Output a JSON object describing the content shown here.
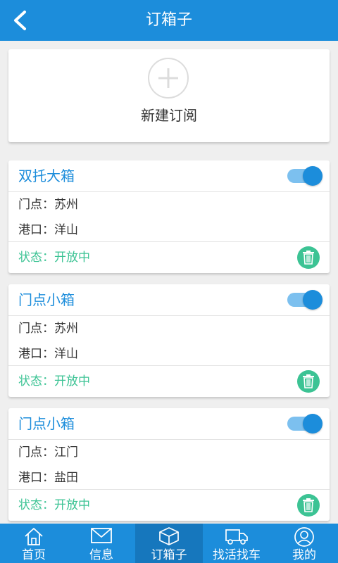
{
  "header": {
    "title": "订箱子"
  },
  "new_subscription": {
    "label": "新建订阅"
  },
  "cards": [
    {
      "title": "双托大箱",
      "door_point": "门点：苏州",
      "port": "港口：洋山",
      "status": "状态：开放中",
      "enabled": true
    },
    {
      "title": "门点小箱",
      "door_point": "门点：苏州",
      "port": "港口：洋山",
      "status": "状态：开放中",
      "enabled": true
    },
    {
      "title": "门点小箱",
      "door_point": "门点：江门",
      "port": "港口：盐田",
      "status": "状态：开放中",
      "enabled": true
    }
  ],
  "tabs": [
    {
      "label": "首页",
      "icon": "home-icon"
    },
    {
      "label": "信息",
      "icon": "mail-icon"
    },
    {
      "label": "订箱子",
      "icon": "box-icon",
      "active": true
    },
    {
      "label": "找活找车",
      "icon": "truck-icon"
    },
    {
      "label": "我的",
      "icon": "user-icon"
    }
  ],
  "colors": {
    "primary": "#1c8ddb",
    "status_green": "#3cc394"
  }
}
